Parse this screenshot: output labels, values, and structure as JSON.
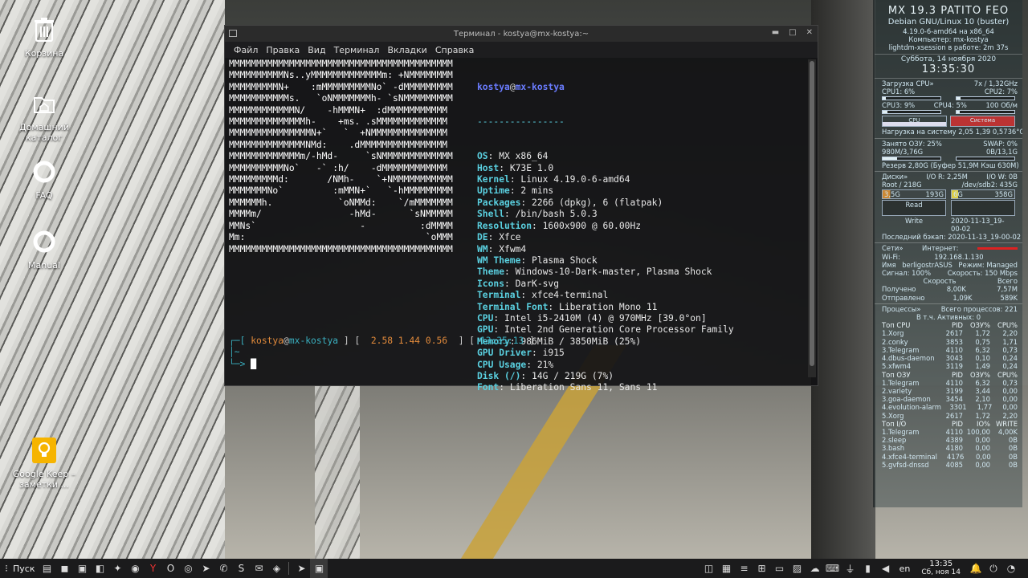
{
  "desktop_icons": [
    {
      "label": "Корзина",
      "icon": "trash-icon"
    },
    {
      "label": "Домашний каталог",
      "icon": "home-folder-icon"
    },
    {
      "label": "FAQ",
      "icon": "lifebuoy-icon"
    },
    {
      "label": "Manual",
      "icon": "lifebuoy-icon"
    },
    {
      "label": "Google Keep – заметки ...",
      "icon": "keep-icon"
    }
  ],
  "terminal": {
    "title": "Терминал - kostya@mx-kostya:~",
    "menu": [
      "Файл",
      "Правка",
      "Вид",
      "Терминал",
      "Вкладки",
      "Справка"
    ],
    "logo": "MMMMMMMMMMMMMMMMMMMMMMMMMMMMMMMMMMMMMMMMM\nMMMMMMMMMMNs..yMMMMMMMMMMMMMm: +NMMMMMMMM\nMMMMMMMMMN+    :mMMMMMMMMMNo` -dMMMMMMMMM\nMMMMMMMMMMMs.   `oNMMMMMMMh- `sNMMMMMMMMM\nMMMMMMMMMMMMN/    -hMMMN+  :dMMMMMMMMMMM\nMMMMMMMMMMMMMMh-    +ms. .sMMMMMMMMMMMMM\nMMMMMMMMMMMMMMMN+`   `  +NMMMMMMMMMMMMMM\nMMMMMMMMMMMMMMNMd:    .dMMMMMMMMMMMMMMMM\nMMMMMMMMMMMMMm/-hMd-     `sNMMMMMMMMMMMMM\nMMMMMMMMMMNo`   -` :h/    -dMMMMMMMMMMMM\nMMMMMMMMMd:       /NMh-    `+NMMMMMMMMMMM\nMMMMMMMNo`         :mMMN+`   `-hMMMMMMMMM\nMMMMMMh.            `oNMMd:    `/mMMMMMMM\nMMMMm/                -hMd-      `sNMMMMM\nMMNs`                   -          :dMMMM\nMm:                                 `oMMM\nMMMMMMMMMMMMMMMMMMMMMMMMMMMMMMMMMMMMMMMMM",
    "user": "kostya",
    "host": "mx-kostya",
    "separator": "----------------",
    "info": [
      {
        "k": "OS",
        "v": "MX x86_64"
      },
      {
        "k": "Host",
        "v": "K73E 1.0"
      },
      {
        "k": "Kernel",
        "v": "Linux 4.19.0-6-amd64"
      },
      {
        "k": "Uptime",
        "v": "2 mins"
      },
      {
        "k": "Packages",
        "v": "2266 (dpkg), 6 (flatpak)"
      },
      {
        "k": "Shell",
        "v": "/bin/bash 5.0.3"
      },
      {
        "k": "Resolution",
        "v": "1600x900 @ 60.00Hz"
      },
      {
        "k": "DE",
        "v": "Xfce"
      },
      {
        "k": "WM",
        "v": "Xfwm4"
      },
      {
        "k": "WM Theme",
        "v": "Plasma Shock"
      },
      {
        "k": "Theme",
        "v": "Windows-10-Dark-master, Plasma Shock"
      },
      {
        "k": "Icons",
        "v": "DarK-svg"
      },
      {
        "k": "Terminal",
        "v": "xfce4-terminal"
      },
      {
        "k": "Terminal Font",
        "v": "Liberation Mono 11"
      },
      {
        "k": "CPU",
        "v": "Intel i5-2410M (4) @ 970MHz [39.0°on]"
      },
      {
        "k": "GPU",
        "v": "Intel 2nd Generation Core Processor Family"
      },
      {
        "k": "Memory",
        "v": "986MiB / 3850MiB (25%)"
      },
      {
        "k": "GPU Driver",
        "v": "i915"
      },
      {
        "k": "CPU Usage",
        "v": "21%"
      },
      {
        "k": "Disk (/)",
        "v": "14G / 219G (7%)"
      },
      {
        "k": "Font",
        "v": "Liberation Sans 11, Sans 11"
      }
    ],
    "prompt_load": "2.58 1.44 0.56",
    "prompt_time": "13:35:13"
  },
  "conky": {
    "title": "MX 19.3 PATITO FEO",
    "distro": "Debian GNU/Linux 10 (buster)",
    "kernel": "4.19.0-6-amd64 на x86_64",
    "computer": "Компьютер: mx-kostya",
    "session": "lightdm-xsession в работе: 2m 37s",
    "date": "Суббота, 14 ноября 2020",
    "time": "13:35:30",
    "cpu_title": "Загрузка CPU»",
    "cpu_freq": "7x / 1,32GHz",
    "cpu1": "CPU1: 6%",
    "cpu2": "CPU2: 7%",
    "cpu3": "CPU3: 9%",
    "cpu4": "CPU4: 5%",
    "cpu_temp_label": "100 Об/м",
    "cpu_graph_cpu": "CPU",
    "cpu_graph_sys": "Система",
    "load": "Нагрузка на систему 2,05 1,39 0,57",
    "temp": "36°C",
    "ram_title": "Занято ОЗУ: 25%",
    "swap_title": "SWAP: 0%",
    "ram_val": "980M/3,76G",
    "swap_val": "0B/13,1G",
    "ram_extra": "Резерв 2,80G (Буфер 51,9M Кэш 630M)",
    "disk_title": "Диски»",
    "disk_io_r": "I/O R: 2,25M",
    "disk_io_w": "I/O W: 0B",
    "root": "Root / 218G",
    "sdb2": "/dev/sdb2: 435G",
    "root_used": "3,5G",
    "root_free": "193G",
    "sdb_used": "6G",
    "sdb_free": "358G",
    "read": "Read",
    "write": "Write",
    "backup_date": "2020-11-13_19-00-02",
    "backup": "Последний бэкап: 2020-11-13_19-00-02",
    "net_title": "Сети»",
    "internet": "Интернет:",
    "wifi": "Wi-Fi:",
    "ip": "192.168.1.130",
    "ssid_label": "Имя",
    "ssid": "berligostrASUS",
    "mode": "Режим: Managed",
    "signal": "Сигнал: 100%",
    "speed": "Скорость: 150 Mbps",
    "col_speed": "Скорость",
    "col_total": "Всего",
    "rx_label": "Получено",
    "rx_speed": "8,00K",
    "rx_total": "7,57M",
    "tx_label": "Отправлено",
    "tx_speed": "1,09K",
    "tx_total": "589K",
    "proc_title": "Процессы»",
    "proc_total": "Всего процессов: 221",
    "proc_active": "В т.ч. Активных: 0",
    "top_cpu_header": [
      "Топ CPU",
      "PID",
      "ОЗУ%",
      "CPU%"
    ],
    "top_cpu": [
      [
        "1.Xorg",
        "2617",
        "1,72",
        "2,20"
      ],
      [
        "2.conky",
        "3853",
        "0,75",
        "1,71"
      ],
      [
        "3.Telegram",
        "4110",
        "6,32",
        "0,73"
      ],
      [
        "4.dbus-daemon",
        "3043",
        "0,10",
        "0,24"
      ],
      [
        "5.xfwm4",
        "3119",
        "1,49",
        "0,24"
      ]
    ],
    "top_mem_header": [
      "Топ ОЗУ",
      "PID",
      "ОЗУ%",
      "CPU%"
    ],
    "top_mem": [
      [
        "1.Telegram",
        "4110",
        "6,32",
        "0,73"
      ],
      [
        "2.variety",
        "3199",
        "3,44",
        "0,00"
      ],
      [
        "3.goa-daemon",
        "3454",
        "2,10",
        "0,00"
      ],
      [
        "4.evolution-alarm",
        "3301",
        "1,77",
        "0,00"
      ],
      [
        "5.Xorg",
        "2617",
        "1,72",
        "2,20"
      ]
    ],
    "top_io_header": [
      "Топ I/O",
      "PID",
      "IO%",
      "WRITE"
    ],
    "top_io": [
      [
        "1.Telegram",
        "4110",
        "100,00",
        "4,00K"
      ],
      [
        "2.sleep",
        "4389",
        "0,00",
        "0B"
      ],
      [
        "3.bash",
        "4180",
        "0,00",
        "0B"
      ],
      [
        "4.xfce4-terminal",
        "4176",
        "0,00",
        "0B"
      ],
      [
        "5.gvfsd-dnssd",
        "4085",
        "0,00",
        "0B"
      ]
    ]
  },
  "taskbar": {
    "start": "Пуск",
    "lang": "en",
    "time": "13:35",
    "date": "Сб, ноя 14"
  }
}
